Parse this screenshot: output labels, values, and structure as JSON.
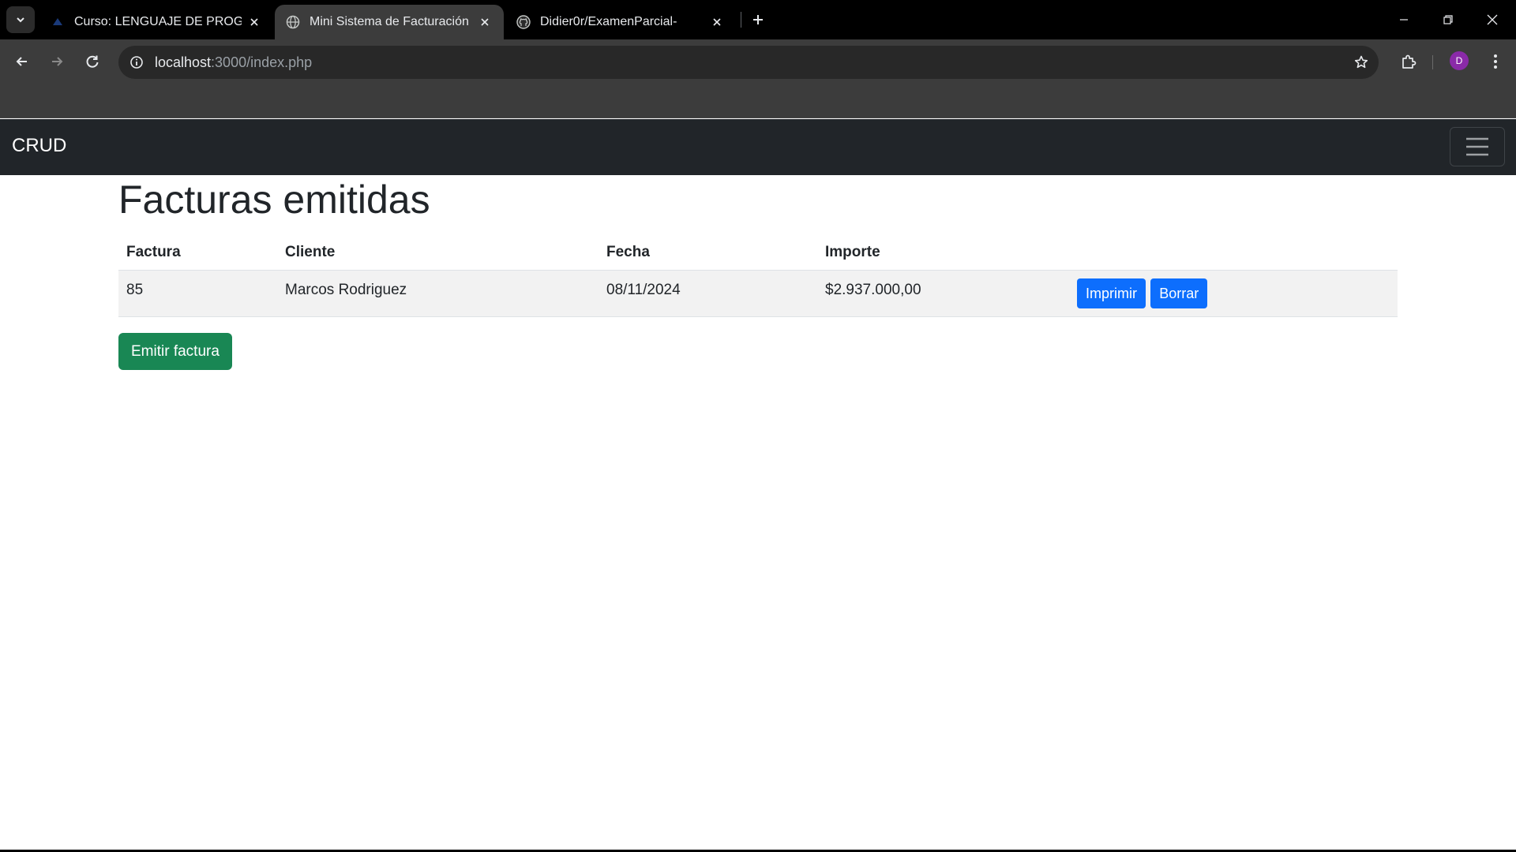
{
  "browser": {
    "tabs": [
      {
        "title": "Curso: LENGUAJE DE PROGRAMACIÓN",
        "active": false,
        "favicon": "moodle-favicon-icon"
      },
      {
        "title": "Mini Sistema de Facturación",
        "active": true,
        "favicon": "globe-icon"
      },
      {
        "title": "Didier0r/ExamenParcial-",
        "active": false,
        "favicon": "github-icon"
      }
    ],
    "address": {
      "host": "localhost",
      "path": ":3000/index.php"
    },
    "profile_initial": "D"
  },
  "navbar": {
    "brand": "CRUD"
  },
  "main": {
    "title": "Facturas emitidas",
    "table": {
      "headers": [
        "Factura",
        "Cliente",
        "Fecha",
        "Importe",
        ""
      ],
      "rows": [
        {
          "factura": "85",
          "cliente": "Marcos Rodriguez",
          "fecha": "08/11/2024",
          "importe": "$2.937.000,00",
          "print_label": "Imprimir",
          "delete_label": "Borrar"
        }
      ]
    },
    "emit_label": "Emitir factura"
  },
  "colors": {
    "primary": "#0d6efd",
    "success": "#198754",
    "navbar": "#212529"
  }
}
